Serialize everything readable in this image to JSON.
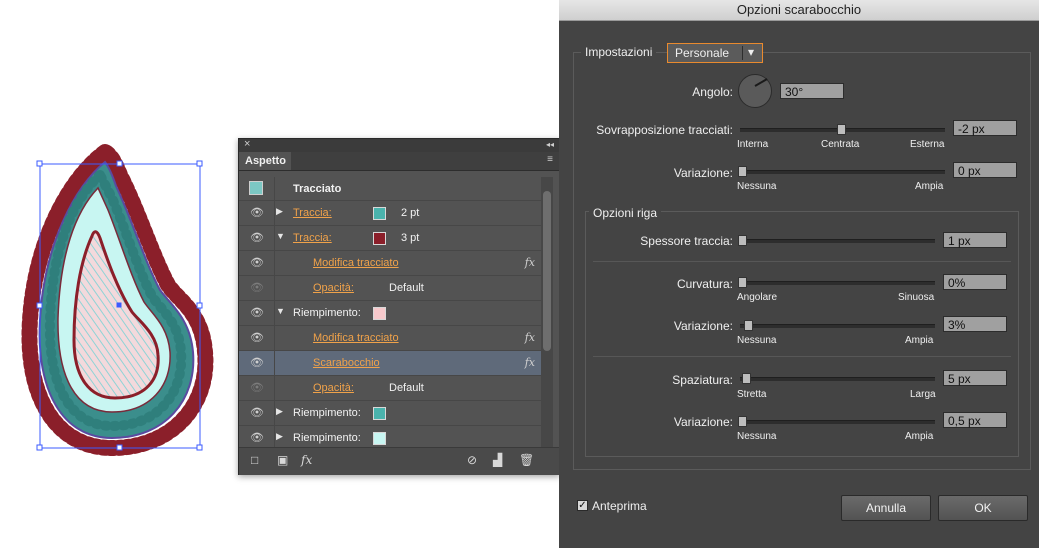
{
  "artwork": {
    "colors": {
      "outline": "#8b1f2a",
      "teal": "#3b8e8c",
      "lightcyan": "#c8f6f2",
      "selection": "#3b5bff"
    }
  },
  "aspetto_panel": {
    "close_icon": "×",
    "collapse_icon": "◂◂",
    "tab_label": "Aspetto",
    "menu_icon": "≡",
    "header": {
      "label": "Tracciato"
    },
    "rows": [
      {
        "type": "stroke",
        "expand": "▶",
        "label": "Traccia:",
        "swatch": "#4ab3ad",
        "value": "2 pt",
        "link": true,
        "eye": "on"
      },
      {
        "type": "stroke",
        "expand": "▼",
        "label": "Traccia:",
        "swatch": "#8b1f2a",
        "value": "3 pt",
        "link": true,
        "eye": "on"
      },
      {
        "type": "effect",
        "label": "Modifica tracciato",
        "fx": "fx",
        "link": true,
        "eye": "on"
      },
      {
        "type": "opacity",
        "label": "Opacità:",
        "value": "Default",
        "link": true,
        "eye": "dim"
      },
      {
        "type": "fill",
        "expand": "▼",
        "label": "Riempimento:",
        "swatch": "#f7c9cc",
        "link": false,
        "eye": "on"
      },
      {
        "type": "effect",
        "label": "Modifica tracciato",
        "fx": "fx",
        "link": true,
        "eye": "on"
      },
      {
        "type": "effect",
        "label": "Scarabocchio",
        "fx": "fx",
        "link": true,
        "eye": "on",
        "selected": true
      },
      {
        "type": "opacity",
        "label": "Opacità:",
        "value": "Default",
        "link": true,
        "eye": "dim"
      },
      {
        "type": "fill",
        "expand": "▶",
        "label": "Riempimento:",
        "swatch": "#4ab3ad",
        "link": false,
        "eye": "on"
      },
      {
        "type": "fill",
        "expand": "▶",
        "label": "Riempimento:",
        "swatch": "#c8f6f2",
        "link": false,
        "eye": "on"
      }
    ],
    "bottom_icons": {
      "new_stroke": "□",
      "new_fill": "▣",
      "fx": "fx",
      "clear": "⊘",
      "duplicate": "▟",
      "delete": "🗑"
    }
  },
  "dialog": {
    "title": "Opzioni scarabocchio",
    "settings_label": "Impostazioni",
    "preset_value": "Personale",
    "preset_arrow": "▾",
    "angle_label": "Angolo:",
    "angle_value": "30°",
    "overlap": {
      "label": "Sovrapposizione tracciati:",
      "value": "-2 px",
      "left": "Interna",
      "mid": "Centrata",
      "right": "Esterna",
      "pos": 0.5
    },
    "overlap_var": {
      "label": "Variazione:",
      "value": "0 px",
      "left": "Nessuna",
      "right": "Ampia",
      "pos": 0.0
    },
    "line_options_label": "Opzioni riga",
    "stroke_width": {
      "label": "Spessore traccia:",
      "value": "1 px",
      "pos": 0.0
    },
    "curviness": {
      "label": "Curvatura:",
      "value": "0%",
      "left": "Angolare",
      "right": "Sinuosa",
      "pos": 0.0
    },
    "curviness_var": {
      "label": "Variazione:",
      "value": "3%",
      "left": "Nessuna",
      "right": "Ampia",
      "pos": 0.03
    },
    "spacing": {
      "label": "Spaziatura:",
      "value": "5 px",
      "left": "Stretta",
      "right": "Larga",
      "pos": 0.02
    },
    "spacing_var": {
      "label": "Variazione:",
      "value": "0,5 px",
      "left": "Nessuna",
      "right": "Ampia",
      "pos": 0.0
    },
    "preview_label": "Anteprima",
    "preview_checked": true,
    "cancel_label": "Annulla",
    "ok_label": "OK"
  }
}
